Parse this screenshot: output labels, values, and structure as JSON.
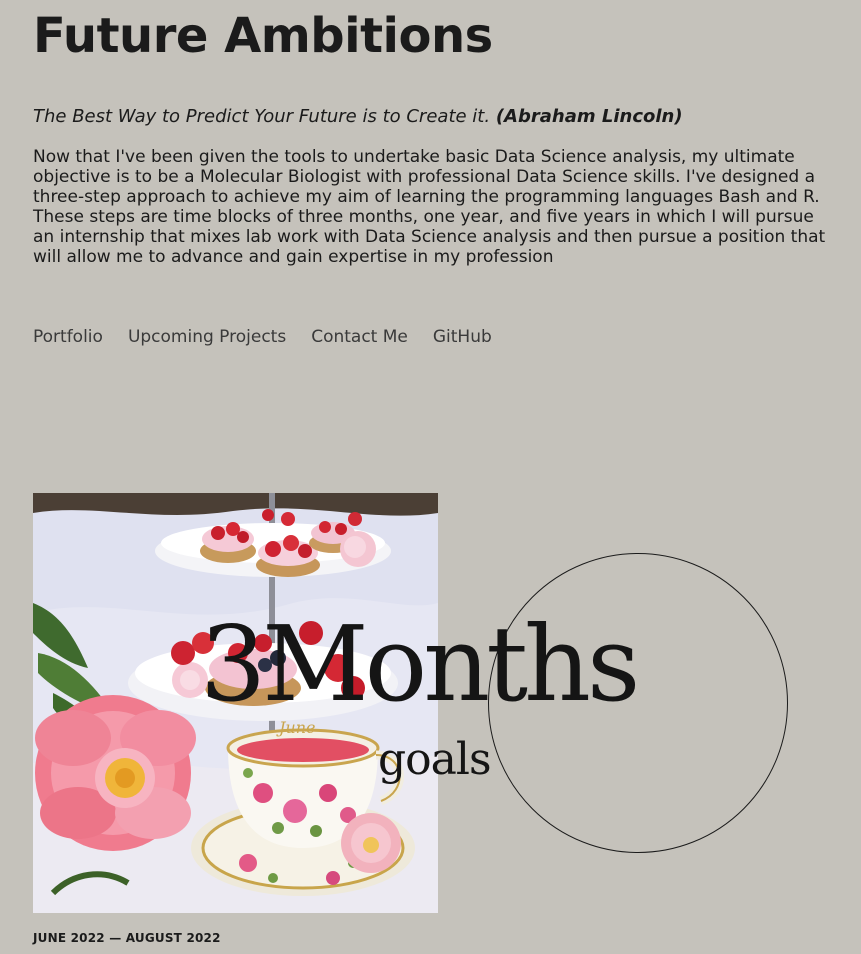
{
  "header": {
    "title": "Future Ambitions"
  },
  "quote": {
    "text": "The Best Way to Predict Your Future is to Create it.",
    "author": "(Abraham Lincoln)"
  },
  "intro": {
    "text": "Now that I've been given the tools to undertake basic Data Science analysis, my ultimate objective is to be a Molecular Biologist with professional Data Science skills. I've designed a three-step approach to achieve my aim of learning the programming languages Bash and R. These steps are time blocks of three months, one year, and five years in which I will pursue an internship that mixes lab work with Data Science analysis and then pursue a position that will allow me to advance and gain expertise in my profession"
  },
  "nav": {
    "items": [
      {
        "label": "Portfolio"
      },
      {
        "label": "Upcoming Projects"
      },
      {
        "label": "Contact Me"
      },
      {
        "label": "GitHub"
      }
    ]
  },
  "section": {
    "heading": "3Months",
    "subheading": "goals",
    "date_range": "JUNE 2022 — AUGUST 2022",
    "image_label": "tea-party-photo"
  },
  "colors": {
    "background": "#c5c2bb",
    "text": "#1b1b1b"
  }
}
